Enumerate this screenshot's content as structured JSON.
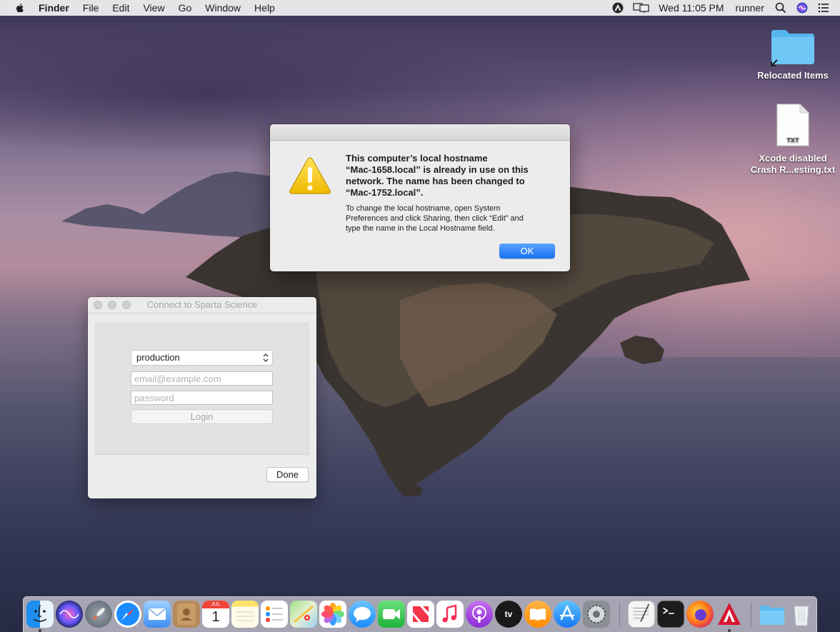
{
  "menubar": {
    "app_name": "Finder",
    "menus": [
      "File",
      "Edit",
      "View",
      "Go",
      "Window",
      "Help"
    ],
    "clock": "Wed 11:05 PM",
    "user": "runner",
    "status_icons": [
      "sparta-icon",
      "display-mirroring-icon",
      "search-icon",
      "siri-icon",
      "control-list-icon"
    ]
  },
  "desktop_icons": {
    "relocated_items": {
      "label": "Relocated Items",
      "icon": "folder-alias-icon"
    },
    "crash_file": {
      "label_line1": "Xcode disabled",
      "label_line2": "Crash R...esting.txt",
      "file_type": "TXT"
    }
  },
  "alert": {
    "title_line1": "This computer’s local hostname",
    "title_line2": "“Mac-1658.local” is already in use on this",
    "title_line3": "network. The name has been changed to",
    "title_line4": "“Mac-1752.local”.",
    "body_line1": "To change the local hostname, open System",
    "body_line2": "Preferences and click Sharing, then click “Edit” and",
    "body_line3": "type the name in the Local Hostname field.",
    "ok_label": "OK",
    "icon": "warning-icon"
  },
  "connect_window": {
    "title": "Connect to Sparta Science",
    "environment_value": "production",
    "email_placeholder": "email@example.com",
    "password_placeholder": "password",
    "login_label": "Login",
    "done_label": "Done"
  },
  "dock": {
    "apps": [
      "Finder",
      "Siri",
      "Launchpad",
      "Safari",
      "Mail",
      "Contacts",
      "Calendar",
      "Notes",
      "Reminders",
      "Maps",
      "Photos",
      "Messages",
      "FaceTime",
      "News",
      "Music",
      "Podcasts",
      "TV",
      "Books",
      "App Store",
      "System Preferences",
      "TextEdit",
      "Terminal",
      "Firefox",
      "Sparta Science",
      "Downloads",
      "Trash"
    ],
    "calendar_month": "JUL",
    "calendar_day": "1",
    "tv_label": "tv",
    "colors": {
      "safari": "#1a8cff",
      "messages": "#2fa8ff",
      "facetime": "#2bc84a",
      "news": "#f4344a",
      "podcasts": "#9b44d8",
      "books": "#ff9500",
      "appstore": "#1a9bff",
      "firefox": "#ff7b1c"
    }
  },
  "wallpaper": {
    "colors": [
      "#3a3455",
      "#a98ea4",
      "#262a44"
    ]
  }
}
